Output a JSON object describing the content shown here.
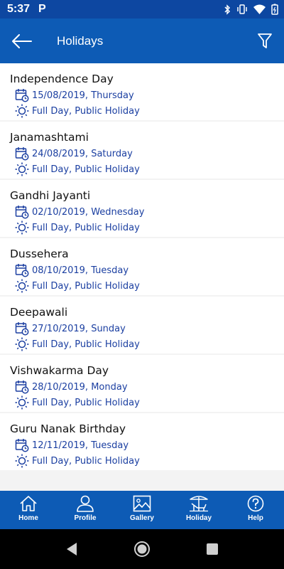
{
  "status_bar": {
    "time": "5:37",
    "notif_letter": "P"
  },
  "app_bar": {
    "title": "Holidays"
  },
  "holidays": [
    {
      "name": "Independence Day",
      "date": "15/08/2019, Thursday",
      "type": "Full Day, Public Holiday"
    },
    {
      "name": "Janamashtami",
      "date": "24/08/2019, Saturday",
      "type": "Full Day, Public Holiday"
    },
    {
      "name": "Gandhi Jayanti",
      "date": "02/10/2019, Wednesday",
      "type": "Full Day, Public Holiday"
    },
    {
      "name": "Dussehera",
      "date": "08/10/2019, Tuesday",
      "type": "Full Day, Public Holiday"
    },
    {
      "name": "Deepawali",
      "date": "27/10/2019, Sunday",
      "type": "Full Day, Public Holiday"
    },
    {
      "name": "Vishwakarma Day",
      "date": "28/10/2019, Monday",
      "type": "Full Day, Public Holiday"
    },
    {
      "name": "Guru Nanak Birthday",
      "date": "12/11/2019, Tuesday",
      "type": "Full Day, Public Holiday"
    }
  ],
  "bottom_nav": [
    {
      "label": "Home",
      "icon": "home-icon"
    },
    {
      "label": "Profile",
      "icon": "profile-icon"
    },
    {
      "label": "Gallery",
      "icon": "gallery-icon"
    },
    {
      "label": "Holiday",
      "icon": "beach-chair-icon"
    },
    {
      "label": "Help",
      "icon": "help-icon"
    }
  ],
  "colors": {
    "primary": "#0d5bb5",
    "status_bar": "#0d47a1",
    "accent_text": "#1b3fa1"
  }
}
